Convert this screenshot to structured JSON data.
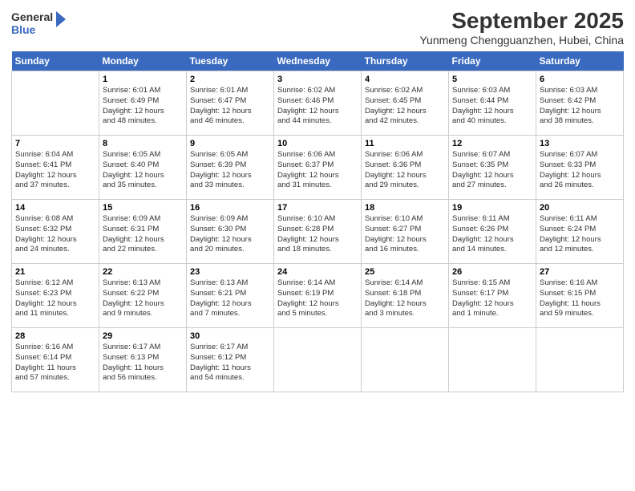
{
  "header": {
    "logo_line1": "General",
    "logo_line2": "Blue",
    "title": "September 2025",
    "subtitle": "Yunmeng Chengguanzhen, Hubei, China"
  },
  "weekdays": [
    "Sunday",
    "Monday",
    "Tuesday",
    "Wednesday",
    "Thursday",
    "Friday",
    "Saturday"
  ],
  "weeks": [
    [
      {
        "day": "",
        "info": ""
      },
      {
        "day": "1",
        "info": "Sunrise: 6:01 AM\nSunset: 6:49 PM\nDaylight: 12 hours\nand 48 minutes."
      },
      {
        "day": "2",
        "info": "Sunrise: 6:01 AM\nSunset: 6:47 PM\nDaylight: 12 hours\nand 46 minutes."
      },
      {
        "day": "3",
        "info": "Sunrise: 6:02 AM\nSunset: 6:46 PM\nDaylight: 12 hours\nand 44 minutes."
      },
      {
        "day": "4",
        "info": "Sunrise: 6:02 AM\nSunset: 6:45 PM\nDaylight: 12 hours\nand 42 minutes."
      },
      {
        "day": "5",
        "info": "Sunrise: 6:03 AM\nSunset: 6:44 PM\nDaylight: 12 hours\nand 40 minutes."
      },
      {
        "day": "6",
        "info": "Sunrise: 6:03 AM\nSunset: 6:42 PM\nDaylight: 12 hours\nand 38 minutes."
      }
    ],
    [
      {
        "day": "7",
        "info": "Sunrise: 6:04 AM\nSunset: 6:41 PM\nDaylight: 12 hours\nand 37 minutes."
      },
      {
        "day": "8",
        "info": "Sunrise: 6:05 AM\nSunset: 6:40 PM\nDaylight: 12 hours\nand 35 minutes."
      },
      {
        "day": "9",
        "info": "Sunrise: 6:05 AM\nSunset: 6:39 PM\nDaylight: 12 hours\nand 33 minutes."
      },
      {
        "day": "10",
        "info": "Sunrise: 6:06 AM\nSunset: 6:37 PM\nDaylight: 12 hours\nand 31 minutes."
      },
      {
        "day": "11",
        "info": "Sunrise: 6:06 AM\nSunset: 6:36 PM\nDaylight: 12 hours\nand 29 minutes."
      },
      {
        "day": "12",
        "info": "Sunrise: 6:07 AM\nSunset: 6:35 PM\nDaylight: 12 hours\nand 27 minutes."
      },
      {
        "day": "13",
        "info": "Sunrise: 6:07 AM\nSunset: 6:33 PM\nDaylight: 12 hours\nand 26 minutes."
      }
    ],
    [
      {
        "day": "14",
        "info": "Sunrise: 6:08 AM\nSunset: 6:32 PM\nDaylight: 12 hours\nand 24 minutes."
      },
      {
        "day": "15",
        "info": "Sunrise: 6:09 AM\nSunset: 6:31 PM\nDaylight: 12 hours\nand 22 minutes."
      },
      {
        "day": "16",
        "info": "Sunrise: 6:09 AM\nSunset: 6:30 PM\nDaylight: 12 hours\nand 20 minutes."
      },
      {
        "day": "17",
        "info": "Sunrise: 6:10 AM\nSunset: 6:28 PM\nDaylight: 12 hours\nand 18 minutes."
      },
      {
        "day": "18",
        "info": "Sunrise: 6:10 AM\nSunset: 6:27 PM\nDaylight: 12 hours\nand 16 minutes."
      },
      {
        "day": "19",
        "info": "Sunrise: 6:11 AM\nSunset: 6:26 PM\nDaylight: 12 hours\nand 14 minutes."
      },
      {
        "day": "20",
        "info": "Sunrise: 6:11 AM\nSunset: 6:24 PM\nDaylight: 12 hours\nand 12 minutes."
      }
    ],
    [
      {
        "day": "21",
        "info": "Sunrise: 6:12 AM\nSunset: 6:23 PM\nDaylight: 12 hours\nand 11 minutes."
      },
      {
        "day": "22",
        "info": "Sunrise: 6:13 AM\nSunset: 6:22 PM\nDaylight: 12 hours\nand 9 minutes."
      },
      {
        "day": "23",
        "info": "Sunrise: 6:13 AM\nSunset: 6:21 PM\nDaylight: 12 hours\nand 7 minutes."
      },
      {
        "day": "24",
        "info": "Sunrise: 6:14 AM\nSunset: 6:19 PM\nDaylight: 12 hours\nand 5 minutes."
      },
      {
        "day": "25",
        "info": "Sunrise: 6:14 AM\nSunset: 6:18 PM\nDaylight: 12 hours\nand 3 minutes."
      },
      {
        "day": "26",
        "info": "Sunrise: 6:15 AM\nSunset: 6:17 PM\nDaylight: 12 hours\nand 1 minute."
      },
      {
        "day": "27",
        "info": "Sunrise: 6:16 AM\nSunset: 6:15 PM\nDaylight: 11 hours\nand 59 minutes."
      }
    ],
    [
      {
        "day": "28",
        "info": "Sunrise: 6:16 AM\nSunset: 6:14 PM\nDaylight: 11 hours\nand 57 minutes."
      },
      {
        "day": "29",
        "info": "Sunrise: 6:17 AM\nSunset: 6:13 PM\nDaylight: 11 hours\nand 56 minutes."
      },
      {
        "day": "30",
        "info": "Sunrise: 6:17 AM\nSunset: 6:12 PM\nDaylight: 11 hours\nand 54 minutes."
      },
      {
        "day": "",
        "info": ""
      },
      {
        "day": "",
        "info": ""
      },
      {
        "day": "",
        "info": ""
      },
      {
        "day": "",
        "info": ""
      }
    ]
  ]
}
